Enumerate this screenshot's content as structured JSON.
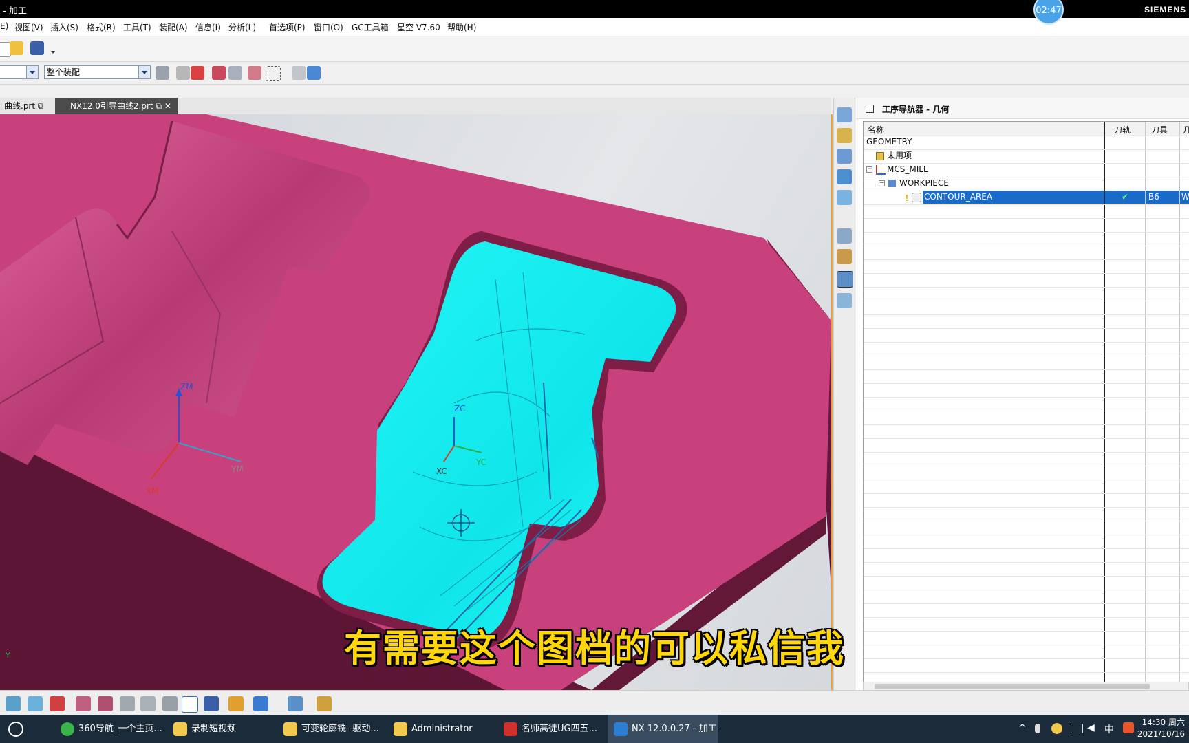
{
  "window": {
    "title": "- 加工",
    "brand": "SIEMENS",
    "timer": "02:47"
  },
  "menu": [
    "E)",
    "视图(V)",
    "插入(S)",
    "格式(R)",
    "工具(T)",
    "装配(A)",
    "信息(I)",
    "分析(L)",
    "首选项(P)",
    "窗口(O)",
    "GC工具箱",
    "星空 V7.60",
    "帮助(H)"
  ],
  "toolbar2": {
    "selection_filter": "",
    "assembly_scope": "整个装配"
  },
  "tabs": [
    {
      "label": "曲线.prt",
      "active": false
    },
    {
      "label": "NX12.0引导曲线2.prt",
      "active": true
    }
  ],
  "viewport": {
    "wcs_labels": {
      "zm": "ZM",
      "xm": "XM",
      "ym": "YM",
      "zc": "ZC",
      "xc": "XC",
      "yc": "YC",
      "corner_y": "Y"
    },
    "part_color": "#c8417c",
    "toolpath_color": "#19f0f0"
  },
  "navigator": {
    "title": "工序导航器 - 几何",
    "columns": [
      "名称",
      "刀轨",
      "刀具",
      "几"
    ],
    "rows": [
      {
        "name": "GEOMETRY",
        "level": 0,
        "toolpath": "",
        "tool": "",
        "geom": ""
      },
      {
        "name": "未用项",
        "level": 1,
        "toolpath": "",
        "tool": "",
        "geom": ""
      },
      {
        "name": "MCS_MILL",
        "level": 1,
        "toolpath": "",
        "tool": "",
        "geom": ""
      },
      {
        "name": "WORKPIECE",
        "level": 2,
        "toolpath": "",
        "tool": "",
        "geom": ""
      },
      {
        "name": "CONTOUR_AREA",
        "level": 3,
        "toolpath": "✔",
        "tool": "B6",
        "geom": "W"
      }
    ]
  },
  "subtitle": "有需要这个图档的可以私信我",
  "taskbar": {
    "items": [
      {
        "label": "360导航_一个主页...",
        "color": "#39b54a"
      },
      {
        "label": "录制短视频",
        "color": "#f2c94c"
      },
      {
        "label": "可变轮廓铣--驱动...",
        "color": "#f2c94c"
      },
      {
        "label": "Administrator",
        "color": "#f2c94c"
      },
      {
        "label": "名师高徒UG四五...",
        "color": "#d0312d"
      },
      {
        "label": "NX 12.0.0.27 - 加工",
        "color": "#2d7dd2"
      }
    ],
    "ime_label": "中",
    "time": "14:30 周六",
    "date": "2021/10/16"
  }
}
